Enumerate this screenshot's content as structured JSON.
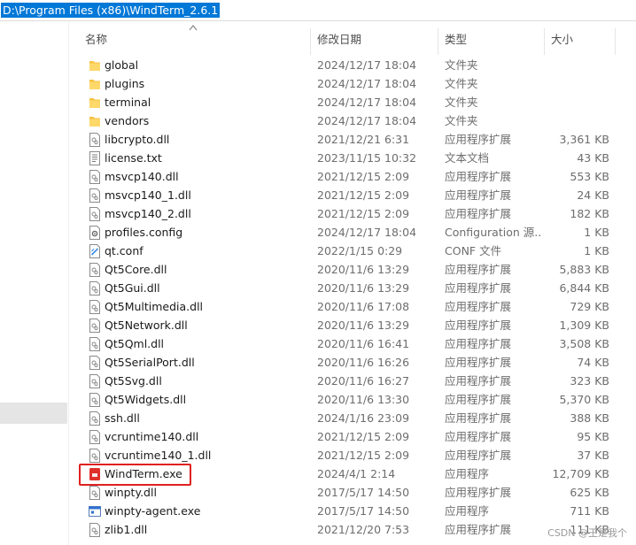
{
  "address_bar": {
    "path": "D:\\Program Files (x86)\\WindTerm_2.6.1"
  },
  "columns": {
    "name": "名称",
    "date": "修改日期",
    "type": "类型",
    "size": "大小"
  },
  "files": [
    {
      "name": "global",
      "date": "2024/12/17 18:04",
      "type": "文件夹",
      "size": "",
      "icon": "folder-icon"
    },
    {
      "name": "plugins",
      "date": "2024/12/17 18:04",
      "type": "文件夹",
      "size": "",
      "icon": "folder-icon"
    },
    {
      "name": "terminal",
      "date": "2024/12/17 18:04",
      "type": "文件夹",
      "size": "",
      "icon": "folder-icon"
    },
    {
      "name": "vendors",
      "date": "2024/12/17 18:04",
      "type": "文件夹",
      "size": "",
      "icon": "folder-icon"
    },
    {
      "name": "libcrypto.dll",
      "date": "2021/12/21 6:31",
      "type": "应用程序扩展",
      "size": "3,361 KB",
      "icon": "dll-file-icon"
    },
    {
      "name": "license.txt",
      "date": "2023/11/15 10:32",
      "type": "文本文档",
      "size": "43 KB",
      "icon": "text-file-icon"
    },
    {
      "name": "msvcp140.dll",
      "date": "2021/12/15 2:09",
      "type": "应用程序扩展",
      "size": "553 KB",
      "icon": "dll-file-icon"
    },
    {
      "name": "msvcp140_1.dll",
      "date": "2021/12/15 2:09",
      "type": "应用程序扩展",
      "size": "24 KB",
      "icon": "dll-file-icon"
    },
    {
      "name": "msvcp140_2.dll",
      "date": "2021/12/15 2:09",
      "type": "应用程序扩展",
      "size": "182 KB",
      "icon": "dll-file-icon"
    },
    {
      "name": "profiles.config",
      "date": "2024/12/17 18:04",
      "type": "Configuration 源...",
      "size": "1 KB",
      "icon": "config-file-icon"
    },
    {
      "name": "qt.conf",
      "date": "2022/1/15 0:29",
      "type": "CONF 文件",
      "size": "1 KB",
      "icon": "conf-file-icon"
    },
    {
      "name": "Qt5Core.dll",
      "date": "2020/11/6 13:29",
      "type": "应用程序扩展",
      "size": "5,883 KB",
      "icon": "dll-file-icon"
    },
    {
      "name": "Qt5Gui.dll",
      "date": "2020/11/6 13:29",
      "type": "应用程序扩展",
      "size": "6,844 KB",
      "icon": "dll-file-icon"
    },
    {
      "name": "Qt5Multimedia.dll",
      "date": "2020/11/6 17:08",
      "type": "应用程序扩展",
      "size": "729 KB",
      "icon": "dll-file-icon"
    },
    {
      "name": "Qt5Network.dll",
      "date": "2020/11/6 13:29",
      "type": "应用程序扩展",
      "size": "1,309 KB",
      "icon": "dll-file-icon"
    },
    {
      "name": "Qt5Qml.dll",
      "date": "2020/11/6 16:41",
      "type": "应用程序扩展",
      "size": "3,508 KB",
      "icon": "dll-file-icon"
    },
    {
      "name": "Qt5SerialPort.dll",
      "date": "2020/11/6 16:26",
      "type": "应用程序扩展",
      "size": "74 KB",
      "icon": "dll-file-icon"
    },
    {
      "name": "Qt5Svg.dll",
      "date": "2020/11/6 16:27",
      "type": "应用程序扩展",
      "size": "323 KB",
      "icon": "dll-file-icon"
    },
    {
      "name": "Qt5Widgets.dll",
      "date": "2020/11/6 13:30",
      "type": "应用程序扩展",
      "size": "5,370 KB",
      "icon": "dll-file-icon"
    },
    {
      "name": "ssh.dll",
      "date": "2024/1/16 23:09",
      "type": "应用程序扩展",
      "size": "388 KB",
      "icon": "dll-file-icon"
    },
    {
      "name": "vcruntime140.dll",
      "date": "2021/12/15 2:09",
      "type": "应用程序扩展",
      "size": "95 KB",
      "icon": "dll-file-icon"
    },
    {
      "name": "vcruntime140_1.dll",
      "date": "2021/12/15 2:09",
      "type": "应用程序扩展",
      "size": "37 KB",
      "icon": "dll-file-icon"
    },
    {
      "name": "WindTerm.exe",
      "date": "2024/4/1 2:14",
      "type": "应用程序",
      "size": "12,709 KB",
      "icon": "windterm-app-icon"
    },
    {
      "name": "winpty.dll",
      "date": "2017/5/17 14:50",
      "type": "应用程序扩展",
      "size": "625 KB",
      "icon": "dll-file-icon"
    },
    {
      "name": "winpty-agent.exe",
      "date": "2017/5/17 14:50",
      "type": "应用程序",
      "size": "711 KB",
      "icon": "exe-file-icon"
    },
    {
      "name": "zlib1.dll",
      "date": "2021/12/20 7:53",
      "type": "应用程序扩展",
      "size": "111 KB",
      "icon": "dll-file-icon"
    }
  ],
  "watermark": "CSDN @王是我个",
  "colors": {
    "selection": "#0078d7",
    "highlight": "#e02020",
    "folder": "#f5c242"
  }
}
